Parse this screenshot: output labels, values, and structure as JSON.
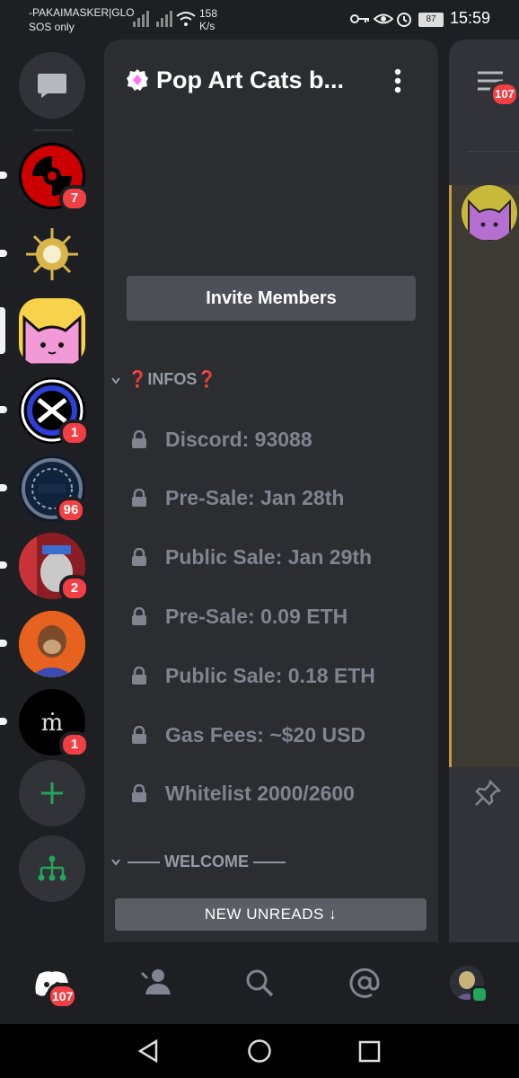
{
  "status_bar": {
    "carrier_line1": "-PAKAIMASKER|GLO",
    "carrier_line2": "SOS only",
    "speed_value": "158",
    "speed_unit": "K/s",
    "battery": "87",
    "time": "15:59"
  },
  "server_rail": {
    "badges": [
      "7",
      "1",
      "96",
      "2",
      "1"
    ]
  },
  "server": {
    "name": "Pop Art Cats b...",
    "invite_label": "Invite Members"
  },
  "categories": {
    "infos": "❓INFOS❓",
    "welcome": "—— WELCOME ——"
  },
  "channels": [
    {
      "name": "Discord: 93088"
    },
    {
      "name": "Pre-Sale: Jan 28th"
    },
    {
      "name": "Public Sale: Jan 29th"
    },
    {
      "name": "Pre-Sale: 0.09 ETH"
    },
    {
      "name": "Public Sale: 0.18 ETH"
    },
    {
      "name": "Gas Fees: ~$20 USD"
    },
    {
      "name": "Whitelist 2000/2600"
    }
  ],
  "new_unreads": "NEW UNREADS ↓",
  "right_panel": {
    "badge": "107"
  },
  "bottom_nav": {
    "home_badge": "107"
  },
  "colors": {
    "accent_green": "#23a55a",
    "badge_red": "#f23f43",
    "panel": "#2b2d31"
  }
}
